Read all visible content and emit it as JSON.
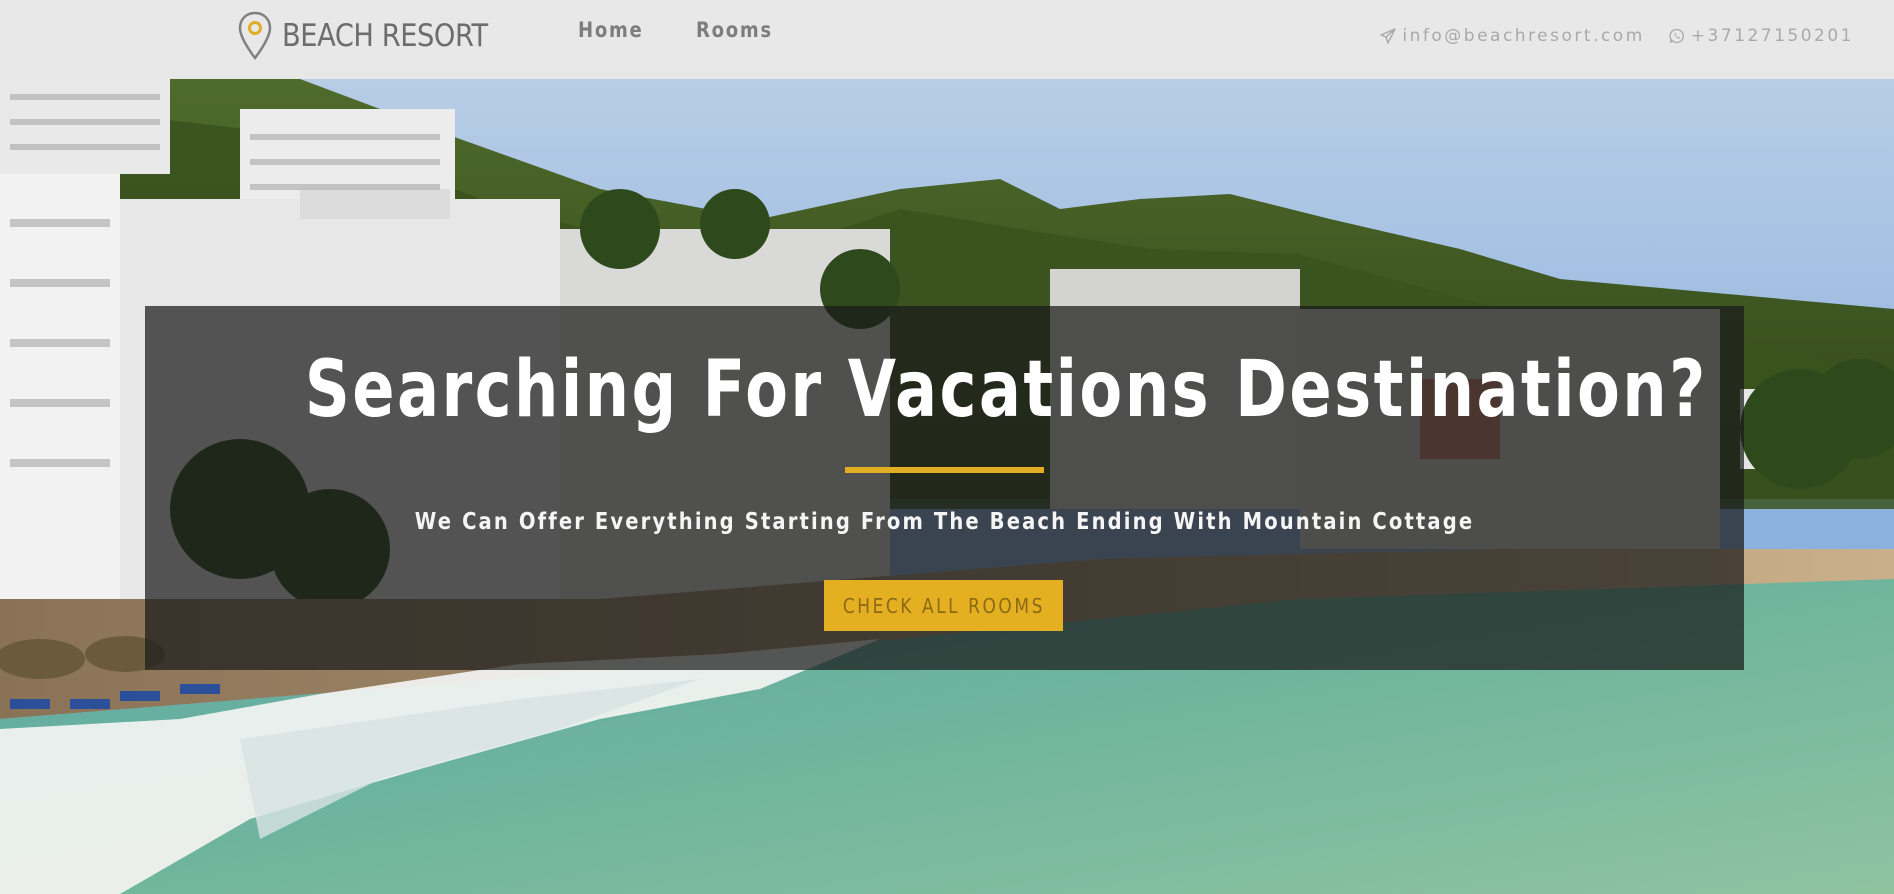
{
  "navbar": {
    "brand": {
      "icon": "map-pin-icon",
      "text": "BEACH RESORT"
    },
    "links": [
      {
        "label": "Home"
      },
      {
        "label": "Rooms"
      }
    ],
    "contact": {
      "email": {
        "icon": "paper-plane-icon",
        "text": "info@beachresort.com"
      },
      "phone": {
        "icon": "whatsapp-icon",
        "text": "+37127150201"
      }
    }
  },
  "hero": {
    "title": "Searching For Vacations Destination?",
    "subtitle": "We Can Offer Everything Starting From The Beach Ending With Mountain Cottage",
    "cta_label": "Check All Rooms"
  },
  "colors": {
    "accent": "#e4b021",
    "navbar_bg": "#e8e8e8",
    "banner_overlay": "rgba(26,26,26,0.72)"
  }
}
